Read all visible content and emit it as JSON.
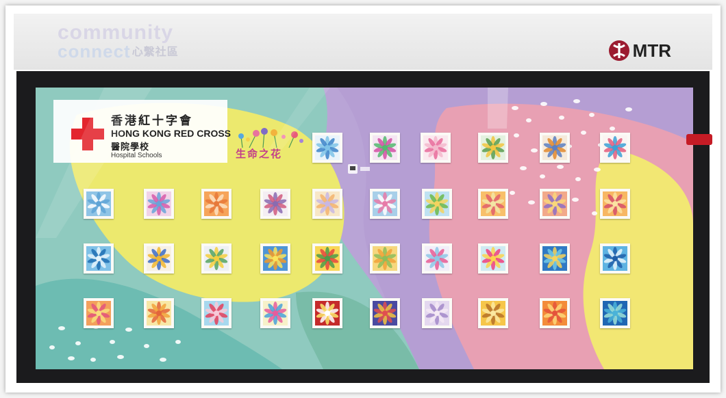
{
  "header": {
    "brand_line1": "community",
    "brand_line2": "connect",
    "brand_zh": "心繫社區",
    "operator": "MTR"
  },
  "banner": {
    "org_zh": "香港紅十字會",
    "org_en": "HONG KONG RED CROSS",
    "school_zh": "醫院學校",
    "school_en": "Hospital Schools",
    "exhibition_title": "生命之花",
    "station_icon": "train-station-icon"
  },
  "colors": {
    "mtr_red": "#9b1b30",
    "red_cross": "#e3262e",
    "yellow": "#ece86c",
    "teal": "#8ccbc0",
    "purple": "#b59ed3",
    "pink": "#e89eb0",
    "dark_frame": "#1b1b1d"
  },
  "artworks": [
    {
      "row": 1,
      "col": 1,
      "theme": "radial-feather",
      "bg": "#eaf4fb",
      "c1": "#3c82c8",
      "c2": "#7fc3e8"
    },
    {
      "row": 1,
      "col": 2,
      "theme": "swirl",
      "bg": "#f5e6f3",
      "c1": "#d24fa3",
      "c2": "#53b86f"
    },
    {
      "row": 1,
      "col": 3,
      "theme": "hearts",
      "bg": "#fbe9ef",
      "c1": "#e86a9a",
      "c2": "#f3b9cc"
    },
    {
      "row": 1,
      "col": 4,
      "theme": "mountain",
      "bg": "#e4f1e0",
      "c1": "#5a9e4d",
      "c2": "#f2c640"
    },
    {
      "row": 1,
      "col": 5,
      "theme": "circle",
      "bg": "#f5eadb",
      "c1": "#e08a2e",
      "c2": "#5b7fc1"
    },
    {
      "row": 1,
      "col": 6,
      "theme": "colorful-flower",
      "bg": "#fbf4f2",
      "c1": "#e25c7e",
      "c2": "#3ba0d6"
    },
    {
      "row": 2,
      "col": 1,
      "theme": "lace",
      "bg": "#8fc4e6",
      "c1": "#ffffff",
      "c2": "#5fa4d6"
    },
    {
      "row": 2,
      "col": 2,
      "theme": "pink-flower",
      "bg": "#f1d3e8",
      "c1": "#d65aa9",
      "c2": "#6aa3d8"
    },
    {
      "row": 2,
      "col": 3,
      "theme": "orange-pattern",
      "bg": "#f6a45a",
      "c1": "#fde2c2",
      "c2": "#e7793a"
    },
    {
      "row": 2,
      "col": 4,
      "theme": "dandelion",
      "bg": "#f4eef3",
      "c1": "#d05a7e",
      "c2": "#8a6bb0"
    },
    {
      "row": 2,
      "col": 5,
      "theme": "pastel-wash",
      "bg": "#f8e7c7",
      "c1": "#f3b36f",
      "c2": "#c8b7e3"
    },
    {
      "row": 2,
      "col": 6,
      "theme": "fuji",
      "bg": "#a8cfe9",
      "c1": "#ffffff",
      "c2": "#e77aa8"
    },
    {
      "row": 2,
      "col": 7,
      "theme": "green-field",
      "bg": "#bfe2f2",
      "c1": "#6cb84b",
      "c2": "#f4d35e"
    },
    {
      "row": 2,
      "col": 8,
      "theme": "sunset",
      "bg": "#f8c06a",
      "c1": "#e25f6b",
      "c2": "#f3e5a5"
    },
    {
      "row": 2,
      "col": 9,
      "theme": "sunset-sea",
      "bg": "#f2a98a",
      "c1": "#8e6fc4",
      "c2": "#f9d77a"
    },
    {
      "row": 2,
      "col": 10,
      "theme": "sunset-hills",
      "bg": "#f7b763",
      "c1": "#d64f6a",
      "c2": "#fbe3a2"
    },
    {
      "row": 3,
      "col": 1,
      "theme": "dolphin",
      "bg": "#7fc1e8",
      "c1": "#1f6fb3",
      "c2": "#e6f5fb"
    },
    {
      "row": 3,
      "col": 2,
      "theme": "sunflower-smile",
      "bg": "#f7f0e3",
      "c1": "#3d6cc6",
      "c2": "#f2b731"
    },
    {
      "row": 3,
      "col": 3,
      "theme": "daisy",
      "bg": "#eef0f4",
      "c1": "#55a360",
      "c2": "#f4cf3e"
    },
    {
      "row": 3,
      "col": 4,
      "theme": "orange-bloom",
      "bg": "#4e95d6",
      "c1": "#f39a2a",
      "c2": "#fbe45c"
    },
    {
      "row": 3,
      "col": 5,
      "theme": "tulips",
      "bg": "#f8d757",
      "c1": "#e6463f",
      "c2": "#4f9a4a"
    },
    {
      "row": 3,
      "col": 6,
      "theme": "yellow-flower",
      "bg": "#f6d77d",
      "c1": "#f1a23a",
      "c2": "#8dbd5a"
    },
    {
      "row": 3,
      "col": 7,
      "theme": "pink-petals",
      "bg": "#f1eef8",
      "c1": "#e85c94",
      "c2": "#8fc7e6"
    },
    {
      "row": 3,
      "col": 8,
      "theme": "pink-daisy",
      "bg": "#cfeaf2",
      "c1": "#f0407e",
      "c2": "#fbd34d"
    },
    {
      "row": 3,
      "col": 9,
      "theme": "ocean-turtle",
      "bg": "#2f79c4",
      "c1": "#71c9e6",
      "c2": "#f6d35c"
    },
    {
      "row": 3,
      "col": 10,
      "theme": "ocean-dolphin",
      "bg": "#5eb3e2",
      "c1": "#e9f6fb",
      "c2": "#1f5fa9"
    },
    {
      "row": 4,
      "col": 1,
      "theme": "warm-wash",
      "bg": "#f3a05c",
      "c1": "#e2537d",
      "c2": "#f8dd7b"
    },
    {
      "row": 4,
      "col": 2,
      "theme": "dots",
      "bg": "#f8e7a6",
      "c1": "#f2a23b",
      "c2": "#e3653b"
    },
    {
      "row": 4,
      "col": 3,
      "theme": "red-flower",
      "bg": "#a7d8ee",
      "c1": "#e5405a",
      "c2": "#f7c9d7"
    },
    {
      "row": 4,
      "col": 4,
      "theme": "rainbow-dandelion",
      "bg": "#f7f1c9",
      "c1": "#4aa1d9",
      "c2": "#e65c9c"
    },
    {
      "row": 4,
      "col": 5,
      "theme": "red-sunburst",
      "bg": "#c42a2a",
      "c1": "#fbe66b",
      "c2": "#ffffff"
    },
    {
      "row": 4,
      "col": 6,
      "theme": "mandala",
      "bg": "#4a4aa0",
      "c1": "#f5c43e",
      "c2": "#e04f4f"
    },
    {
      "row": 4,
      "col": 7,
      "theme": "lavender",
      "bg": "#e4d8ef",
      "c1": "#a38ac9",
      "c2": "#f5e9f4"
    },
    {
      "row": 4,
      "col": 8,
      "theme": "gold-dots",
      "bg": "#f6c64a",
      "c1": "#b67128",
      "c2": "#fbe8a0"
    },
    {
      "row": 4,
      "col": 9,
      "theme": "orange-circles",
      "bg": "#f38c3a",
      "c1": "#fbd77a",
      "c2": "#e4533b"
    },
    {
      "row": 4,
      "col": 10,
      "theme": "blue-glow",
      "bg": "#1f66b3",
      "c1": "#9ce0d7",
      "c2": "#4ab3d8"
    }
  ]
}
